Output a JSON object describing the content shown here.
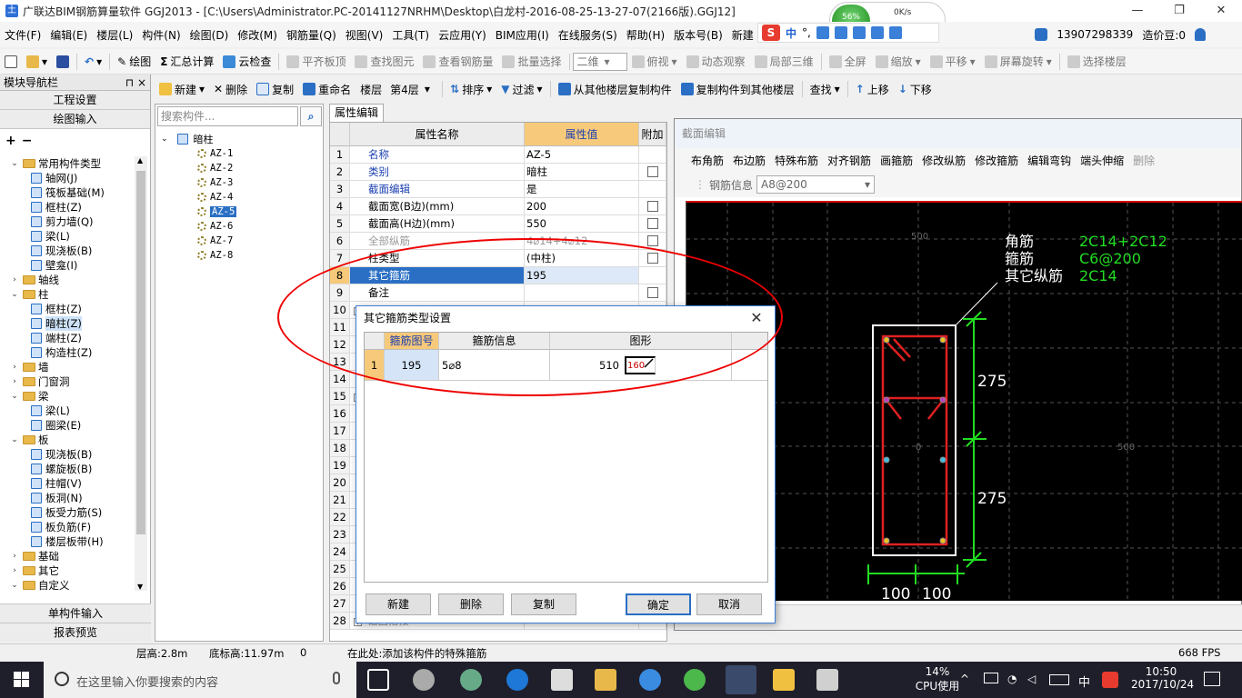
{
  "window": {
    "app_icon": "土",
    "title": "广联达BIM钢筋算量软件 GGJ2013 - [C:\\Users\\Administrator.PC-20141127NRHM\\Desktop\\白龙村-2016-08-25-13-27-07(2166版).GGJ12]",
    "controls": [
      "—",
      "❐",
      "✕"
    ]
  },
  "net_widget": {
    "percent": "56%",
    "speed_up": "0K/s"
  },
  "menu": [
    "文件(F)",
    "编辑(E)",
    "楼层(L)",
    "构件(N)",
    "绘图(D)",
    "修改(M)",
    "钢筋量(Q)",
    "视图(V)",
    "工具(T)",
    "云应用(Y)",
    "BIM应用(I)",
    "在线服务(S)",
    "帮助(H)",
    "版本号(B)",
    "新建"
  ],
  "menu_right": {
    "phone": "13907298339",
    "cost": "造价豆:0"
  },
  "ime": {
    "logo": "S",
    "lang": "中",
    "punct": "°,"
  },
  "toolbar1": {
    "draw": "绘图",
    "sum": "汇总计算",
    "cloud_check": "云检查",
    "flat_slab": "平齐板顶",
    "find_elem": "查找图元",
    "view_rebar": "查看钢筋量",
    "batch_select": "批量选择",
    "view_mode": "二维",
    "top_view": "俯视",
    "dynamic": "动态观察",
    "local_3d": "局部三维",
    "fullscreen": "全屏",
    "zoom": "缩放",
    "pan": "平移",
    "rotate": "屏幕旋转",
    "select_floor": "选择楼层"
  },
  "toolbar2": {
    "new": "新建",
    "delete": "删除",
    "copy": "复制",
    "rename": "重命名",
    "floor_label": "楼层",
    "floor_value": "第4层",
    "sort": "排序",
    "filter": "过滤",
    "copy_from": "从其他楼层复制构件",
    "copy_to": "复制构件到其他楼层",
    "find": "查找",
    "move_up": "上移",
    "move_down": "下移"
  },
  "nav": {
    "header": "模块导航栏",
    "pin": "⊓",
    "close": "×",
    "sections": [
      "工程设置",
      "绘图输入"
    ],
    "bottom": [
      "单构件输入",
      "报表预览"
    ],
    "tree": [
      {
        "level": 0,
        "toggle": "⌄",
        "type": "folder",
        "label": "常用构件类型"
      },
      {
        "level": 1,
        "type": "comp",
        "label": "轴网(J)"
      },
      {
        "level": 1,
        "type": "comp",
        "label": "筏板基础(M)"
      },
      {
        "level": 1,
        "type": "comp",
        "label": "框柱(Z)"
      },
      {
        "level": 1,
        "type": "comp",
        "label": "剪力墙(Q)"
      },
      {
        "level": 1,
        "type": "comp",
        "label": "梁(L)"
      },
      {
        "level": 1,
        "type": "comp",
        "label": "现浇板(B)"
      },
      {
        "level": 1,
        "type": "comp",
        "label": "壁龛(I)"
      },
      {
        "level": 0,
        "toggle": "›",
        "type": "folder",
        "label": "轴线"
      },
      {
        "level": 0,
        "toggle": "⌄",
        "type": "folder",
        "label": "柱"
      },
      {
        "level": 1,
        "type": "comp",
        "label": "框柱(Z)"
      },
      {
        "level": 1,
        "type": "comp",
        "label": "暗柱(Z)",
        "selected": true
      },
      {
        "level": 1,
        "type": "comp",
        "label": "端柱(Z)"
      },
      {
        "level": 1,
        "type": "comp",
        "label": "构造柱(Z)"
      },
      {
        "level": 0,
        "toggle": "›",
        "type": "folder",
        "label": "墙"
      },
      {
        "level": 0,
        "toggle": "›",
        "type": "folder",
        "label": "门窗洞"
      },
      {
        "level": 0,
        "toggle": "⌄",
        "type": "folder",
        "label": "梁"
      },
      {
        "level": 1,
        "type": "comp",
        "label": "梁(L)"
      },
      {
        "level": 1,
        "type": "comp",
        "label": "圈梁(E)"
      },
      {
        "level": 0,
        "toggle": "⌄",
        "type": "folder",
        "label": "板"
      },
      {
        "level": 1,
        "type": "comp",
        "label": "现浇板(B)"
      },
      {
        "level": 1,
        "type": "comp",
        "label": "螺旋板(B)"
      },
      {
        "level": 1,
        "type": "comp",
        "label": "柱帽(V)"
      },
      {
        "level": 1,
        "type": "comp",
        "label": "板洞(N)"
      },
      {
        "level": 1,
        "type": "comp",
        "label": "板受力筋(S)"
      },
      {
        "level": 1,
        "type": "comp",
        "label": "板负筋(F)"
      },
      {
        "level": 1,
        "type": "comp",
        "label": "楼层板带(H)"
      },
      {
        "level": 0,
        "toggle": "›",
        "type": "folder",
        "label": "基础"
      },
      {
        "level": 0,
        "toggle": "›",
        "type": "folder",
        "label": "其它"
      },
      {
        "level": 0,
        "toggle": "⌄",
        "type": "folder",
        "label": "自定义"
      }
    ]
  },
  "complist": {
    "search_placeholder": "搜索构件...",
    "root": "暗柱",
    "items": [
      "AZ-1",
      "AZ-2",
      "AZ-3",
      "AZ-4",
      "AZ-5",
      "AZ-6",
      "AZ-7",
      "AZ-8"
    ],
    "selected_index": 4
  },
  "props": {
    "tab": "属性编辑",
    "headers": {
      "name": "属性名称",
      "value": "属性值",
      "extra": "附加"
    },
    "rows": [
      {
        "n": "1",
        "name": "名称",
        "value": "AZ-5",
        "style": "blue",
        "check": false
      },
      {
        "n": "2",
        "name": "类别",
        "value": "暗柱",
        "style": "blue",
        "check": true
      },
      {
        "n": "3",
        "name": "截面编辑",
        "value": "是",
        "style": "blue",
        "check": false
      },
      {
        "n": "4",
        "name": "截面宽(B边)(mm)",
        "value": "200",
        "style": "",
        "check": true
      },
      {
        "n": "5",
        "name": "截面高(H边)(mm)",
        "value": "550",
        "style": "",
        "check": true
      },
      {
        "n": "6",
        "name": "全部纵筋",
        "value": "4⌀14+4⌀12",
        "style": "gray",
        "check": true
      },
      {
        "n": "7",
        "name": "柱类型",
        "value": "(中柱)",
        "style": "",
        "check": true
      },
      {
        "n": "8",
        "name": "其它箍筋",
        "value": "195",
        "style": "",
        "check": false,
        "selected": true
      },
      {
        "n": "9",
        "name": "备注",
        "value": "",
        "style": "",
        "check": true
      },
      {
        "n": "10",
        "name": "",
        "value": "",
        "style": "",
        "check": false,
        "expander": "−"
      },
      {
        "n": "11"
      },
      {
        "n": "12"
      },
      {
        "n": "13"
      },
      {
        "n": "14"
      },
      {
        "n": "15",
        "expander": "−"
      },
      {
        "n": "16"
      },
      {
        "n": "17"
      },
      {
        "n": "18"
      },
      {
        "n": "19"
      },
      {
        "n": "20"
      },
      {
        "n": "21"
      },
      {
        "n": "22"
      },
      {
        "n": "23"
      },
      {
        "n": "24"
      },
      {
        "n": "25"
      },
      {
        "n": "26"
      },
      {
        "n": "27"
      },
      {
        "n": "28",
        "expander": "+",
        "name": "锚固搭接"
      }
    ]
  },
  "section": {
    "title": "截面编辑",
    "tools": [
      "布角筋",
      "布边筋",
      "特殊布筋",
      "对齐钢筋",
      "画箍筋",
      "修改纵筋",
      "修改箍筋",
      "编辑弯钩",
      "端头伸缩",
      "删除"
    ],
    "info_label": "钢筋信息",
    "info_value": "A8@200",
    "legend": [
      {
        "label": "角筋",
        "value": "2C14+2C12"
      },
      {
        "label": "箍筋",
        "value": "C6@200"
      },
      {
        "label": "其它纵筋",
        "value": "2C14"
      }
    ],
    "dims": {
      "h1": "275",
      "h2": "275",
      "w1": "100",
      "w2": "100"
    },
    "grid_labels": {
      "top": "500",
      "right": "500",
      "center": "0"
    }
  },
  "dialog": {
    "title": "其它箍筋类型设置",
    "close": "✕",
    "headers": {
      "code": "箍筋图号",
      "info": "箍筋信息",
      "shape": "图形"
    },
    "rows": [
      {
        "n": "1",
        "code": "195",
        "info": "5⌀8",
        "len": "510",
        "inner": "160"
      }
    ],
    "buttons": {
      "new": "新建",
      "delete": "删除",
      "copy": "复制",
      "ok": "确定",
      "cancel": "取消"
    }
  },
  "status": {
    "floor_height": "层高:2.8m",
    "base_height": "底标高:11.97m",
    "zero": "0",
    "hint": "在此处:添加该构件的特殊箍筋",
    "fps": "668 FPS"
  },
  "taskbar": {
    "search": "在这里输入你要搜索的内容",
    "cpu_percent": "14%",
    "cpu_label": "CPU使用",
    "lang": "中",
    "time": "10:50",
    "date": "2017/10/24"
  },
  "colors": {
    "accent": "#2a6fc4",
    "highlight": "#f7c97a",
    "annotation": "#e00000",
    "rebar": "#e02020",
    "dim": "#22dd22"
  }
}
